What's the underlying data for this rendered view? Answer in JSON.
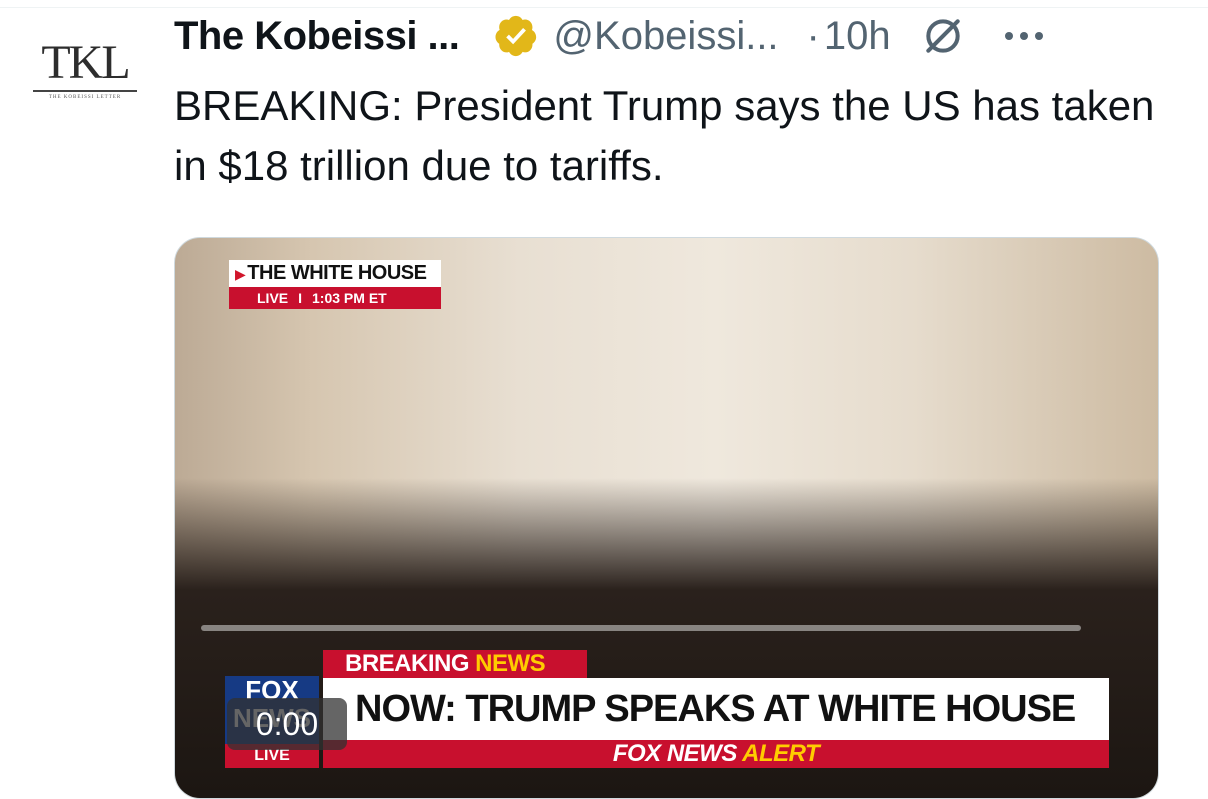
{
  "author": {
    "avatar_text": "TKL",
    "avatar_subtext": "THE KOBEISSI LETTER",
    "name": "The Kobeissi ...",
    "handle": "@Kobeissi...",
    "separator": "·",
    "time": "10h"
  },
  "post": {
    "text": "BREAKING: President Trump says the US has taken in $18 trillion due to tariffs."
  },
  "video": {
    "location_tag": "THE WHITE HOUSE",
    "live_label": "LIVE",
    "live_sep": "I",
    "live_time": "1:03 PM ET",
    "breaking_label_1": "BREAKING ",
    "breaking_label_2": "NEWS",
    "headline": "NOW: TRUMP SPEAKS AT WHITE HOUSE",
    "alert_label_1": "FOX NEWS ",
    "alert_label_2": "ALERT",
    "network_logo_text": "FOX NEWS",
    "network_live_text": "LIVE",
    "timestamp": "0:00",
    "progress": 0
  },
  "colors": {
    "verified_badge": "#e2b719",
    "accent_red": "#c8102e",
    "fox_blue": "#163a84",
    "secondary_text": "#536471"
  },
  "icons": {
    "verified": "verified-badge-icon",
    "grok": "grok-icon",
    "more": "more-icon"
  }
}
